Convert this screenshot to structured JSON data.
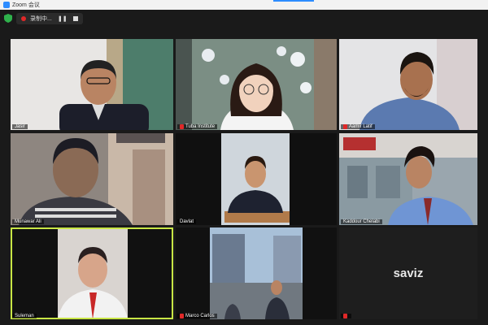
{
  "window": {
    "title": "Zoom 会议"
  },
  "recording": {
    "label": "录制中...",
    "pause_glyph": "❚❚"
  },
  "participants": [
    {
      "name": "Jasir",
      "muted": false,
      "active": false
    },
    {
      "name": "Tuba Institute",
      "muted": true,
      "active": false
    },
    {
      "name": "Aamir Latif",
      "muted": true,
      "active": false
    },
    {
      "name": "Munawar Ali",
      "muted": false,
      "active": false
    },
    {
      "name": "Davlat",
      "muted": false,
      "active": false
    },
    {
      "name": "Kaddour Chelabi",
      "muted": false,
      "active": false
    },
    {
      "name": "Suleman",
      "muted": false,
      "active": true
    },
    {
      "name": "Marco Carlos",
      "muted": true,
      "active": false
    },
    {
      "name": "",
      "muted": true,
      "active": false,
      "display_name": "saviz"
    }
  ],
  "colors": {
    "accent": "#2d8cff",
    "active_border": "#c8e645",
    "mute": "#e02828"
  }
}
